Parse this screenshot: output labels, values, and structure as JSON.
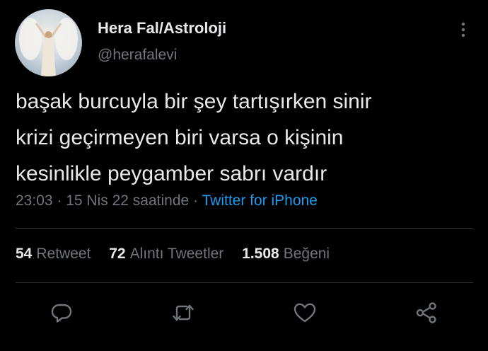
{
  "author": {
    "display_name": "Hera Fal/Astroloji",
    "handle": "@herafalevi"
  },
  "tweet": {
    "text": "başak burcuyla bir şey tartışırken sinir\nkrizi geçirmeyen biri varsa o kişinin\nkesinlikle peygamber sabrı vardır",
    "time": "23:03",
    "separator": " · ",
    "date": "15 Nis 22 saatinde",
    "source": "Twitter for iPhone"
  },
  "stats": {
    "retweets_count": "54",
    "retweets_label": "Retweet",
    "quotes_count": "72",
    "quotes_label": "Alıntı Tweetler",
    "likes_count": "1.508",
    "likes_label": "Beğeni"
  },
  "icons": {
    "more": "more-vertical-icon",
    "reply": "reply-icon",
    "retweet": "retweet-icon",
    "like": "heart-icon",
    "share": "share-icon"
  },
  "colors": {
    "background": "#000000",
    "text": "#e7e9ea",
    "secondary": "#71767b",
    "link": "#1d9bf0",
    "divider": "#2f3336"
  }
}
